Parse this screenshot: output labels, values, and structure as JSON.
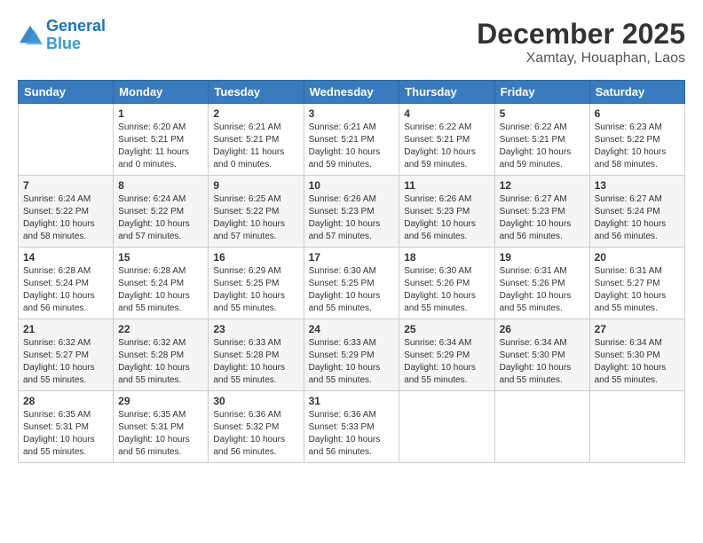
{
  "header": {
    "logo_line1": "General",
    "logo_line2": "Blue",
    "month": "December 2025",
    "location": "Xamtay, Houaphan, Laos"
  },
  "weekdays": [
    "Sunday",
    "Monday",
    "Tuesday",
    "Wednesday",
    "Thursday",
    "Friday",
    "Saturday"
  ],
  "weeks": [
    [
      {
        "day": "",
        "info": ""
      },
      {
        "day": "1",
        "info": "Sunrise: 6:20 AM\nSunset: 5:21 PM\nDaylight: 11 hours\nand 0 minutes."
      },
      {
        "day": "2",
        "info": "Sunrise: 6:21 AM\nSunset: 5:21 PM\nDaylight: 11 hours\nand 0 minutes."
      },
      {
        "day": "3",
        "info": "Sunrise: 6:21 AM\nSunset: 5:21 PM\nDaylight: 10 hours\nand 59 minutes."
      },
      {
        "day": "4",
        "info": "Sunrise: 6:22 AM\nSunset: 5:21 PM\nDaylight: 10 hours\nand 59 minutes."
      },
      {
        "day": "5",
        "info": "Sunrise: 6:22 AM\nSunset: 5:21 PM\nDaylight: 10 hours\nand 59 minutes."
      },
      {
        "day": "6",
        "info": "Sunrise: 6:23 AM\nSunset: 5:22 PM\nDaylight: 10 hours\nand 58 minutes."
      }
    ],
    [
      {
        "day": "7",
        "info": "Sunrise: 6:24 AM\nSunset: 5:22 PM\nDaylight: 10 hours\nand 58 minutes."
      },
      {
        "day": "8",
        "info": "Sunrise: 6:24 AM\nSunset: 5:22 PM\nDaylight: 10 hours\nand 57 minutes."
      },
      {
        "day": "9",
        "info": "Sunrise: 6:25 AM\nSunset: 5:22 PM\nDaylight: 10 hours\nand 57 minutes."
      },
      {
        "day": "10",
        "info": "Sunrise: 6:26 AM\nSunset: 5:23 PM\nDaylight: 10 hours\nand 57 minutes."
      },
      {
        "day": "11",
        "info": "Sunrise: 6:26 AM\nSunset: 5:23 PM\nDaylight: 10 hours\nand 56 minutes."
      },
      {
        "day": "12",
        "info": "Sunrise: 6:27 AM\nSunset: 5:23 PM\nDaylight: 10 hours\nand 56 minutes."
      },
      {
        "day": "13",
        "info": "Sunrise: 6:27 AM\nSunset: 5:24 PM\nDaylight: 10 hours\nand 56 minutes."
      }
    ],
    [
      {
        "day": "14",
        "info": "Sunrise: 6:28 AM\nSunset: 5:24 PM\nDaylight: 10 hours\nand 56 minutes."
      },
      {
        "day": "15",
        "info": "Sunrise: 6:28 AM\nSunset: 5:24 PM\nDaylight: 10 hours\nand 55 minutes."
      },
      {
        "day": "16",
        "info": "Sunrise: 6:29 AM\nSunset: 5:25 PM\nDaylight: 10 hours\nand 55 minutes."
      },
      {
        "day": "17",
        "info": "Sunrise: 6:30 AM\nSunset: 5:25 PM\nDaylight: 10 hours\nand 55 minutes."
      },
      {
        "day": "18",
        "info": "Sunrise: 6:30 AM\nSunset: 5:26 PM\nDaylight: 10 hours\nand 55 minutes."
      },
      {
        "day": "19",
        "info": "Sunrise: 6:31 AM\nSunset: 5:26 PM\nDaylight: 10 hours\nand 55 minutes."
      },
      {
        "day": "20",
        "info": "Sunrise: 6:31 AM\nSunset: 5:27 PM\nDaylight: 10 hours\nand 55 minutes."
      }
    ],
    [
      {
        "day": "21",
        "info": "Sunrise: 6:32 AM\nSunset: 5:27 PM\nDaylight: 10 hours\nand 55 minutes."
      },
      {
        "day": "22",
        "info": "Sunrise: 6:32 AM\nSunset: 5:28 PM\nDaylight: 10 hours\nand 55 minutes."
      },
      {
        "day": "23",
        "info": "Sunrise: 6:33 AM\nSunset: 5:28 PM\nDaylight: 10 hours\nand 55 minutes."
      },
      {
        "day": "24",
        "info": "Sunrise: 6:33 AM\nSunset: 5:29 PM\nDaylight: 10 hours\nand 55 minutes."
      },
      {
        "day": "25",
        "info": "Sunrise: 6:34 AM\nSunset: 5:29 PM\nDaylight: 10 hours\nand 55 minutes."
      },
      {
        "day": "26",
        "info": "Sunrise: 6:34 AM\nSunset: 5:30 PM\nDaylight: 10 hours\nand 55 minutes."
      },
      {
        "day": "27",
        "info": "Sunrise: 6:34 AM\nSunset: 5:30 PM\nDaylight: 10 hours\nand 55 minutes."
      }
    ],
    [
      {
        "day": "28",
        "info": "Sunrise: 6:35 AM\nSunset: 5:31 PM\nDaylight: 10 hours\nand 55 minutes."
      },
      {
        "day": "29",
        "info": "Sunrise: 6:35 AM\nSunset: 5:31 PM\nDaylight: 10 hours\nand 56 minutes."
      },
      {
        "day": "30",
        "info": "Sunrise: 6:36 AM\nSunset: 5:32 PM\nDaylight: 10 hours\nand 56 minutes."
      },
      {
        "day": "31",
        "info": "Sunrise: 6:36 AM\nSunset: 5:33 PM\nDaylight: 10 hours\nand 56 minutes."
      },
      {
        "day": "",
        "info": ""
      },
      {
        "day": "",
        "info": ""
      },
      {
        "day": "",
        "info": ""
      }
    ]
  ]
}
